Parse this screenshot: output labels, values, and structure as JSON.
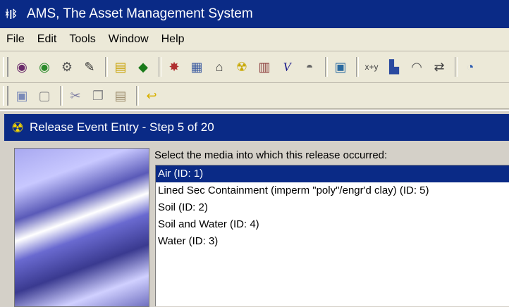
{
  "window": {
    "title": "AMS, The Asset Management System",
    "app_icon": "ams-logo-icon"
  },
  "menu": [
    "File",
    "Edit",
    "Tools",
    "Window",
    "Help"
  ],
  "toolbar1": {
    "icons": [
      "globe-icon",
      "globe-green-icon",
      "gears-icon",
      "wand-icon",
      "clipboard-icon",
      "book-icon",
      "sparkle-icon",
      "form-icon",
      "tag-icon",
      "radiation-icon",
      "building-icon",
      "v-icon",
      "bucket-icon",
      "chart-icon"
    ],
    "formula_label": "x+y",
    "icons_after": [
      "monitor-icon",
      "gauge-icon",
      "swap-icon"
    ]
  },
  "toolbar2": {
    "icons": [
      "save-icon",
      "print-preview-icon",
      "cut-icon",
      "copy-icon",
      "paste-icon",
      "undo-icon"
    ]
  },
  "dialog": {
    "title": "Release Event Entry - Step 5 of 20",
    "icon": "radiation-icon",
    "prompt": "Select the media into which this release occurred:",
    "items": [
      "Air (ID: 1)",
      "Lined Sec Containment (imperm \"poly\"/engr'd clay) (ID: 5)",
      "Soil (ID: 2)",
      "Soil and Water (ID: 4)",
      "Water (ID: 3)"
    ],
    "selected_index": 0
  }
}
